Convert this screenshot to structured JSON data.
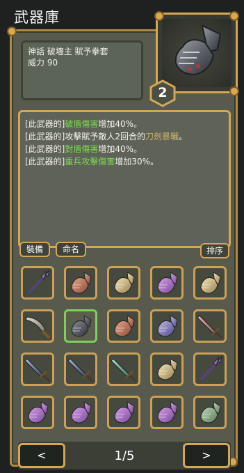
{
  "header": {
    "title": "武器庫"
  },
  "weapon": {
    "name": "神話  破墻主 賦予拳套",
    "power": "威力 90",
    "count": "2",
    "effects": [
      {
        "prefix": "[此武器的]",
        "highlight": "破盾傷害",
        "suffix": "增加40%。",
        "color": "green"
      },
      {
        "prefix": "[此武器的]攻擊賦予敵人2回合的",
        "highlight": "刀劍暴曬",
        "suffix": "。",
        "color": "gold"
      },
      {
        "prefix": "[此武器的]",
        "highlight": "對盾傷害",
        "suffix": "增加40%。",
        "color": "green"
      },
      {
        "prefix": "[此武器的]",
        "highlight": "重兵攻擊傷害",
        "suffix": "增加30%。",
        "color": "green"
      }
    ]
  },
  "buttons": {
    "equip": "裝備",
    "rename": "命名",
    "sort": "排序"
  },
  "inventory": [
    {
      "type": "spear",
      "tone": "purple"
    },
    {
      "type": "gauntlet",
      "tone": "copper"
    },
    {
      "type": "gauntlet",
      "tone": "gold"
    },
    {
      "type": "gauntlet",
      "tone": "violet"
    },
    {
      "type": "gauntlet",
      "tone": "gold"
    },
    {
      "type": "scimitar",
      "tone": "silver"
    },
    {
      "type": "gauntlet",
      "tone": "dark",
      "selected": true
    },
    {
      "type": "gauntlet",
      "tone": "copper"
    },
    {
      "type": "gauntlet",
      "tone": "royal"
    },
    {
      "type": "sword",
      "tone": "rose"
    },
    {
      "type": "sword",
      "tone": "steelblue"
    },
    {
      "type": "sword",
      "tone": "steelblue"
    },
    {
      "type": "sword",
      "tone": "jade"
    },
    {
      "type": "gauntlet",
      "tone": "gold"
    },
    {
      "type": "spear",
      "tone": "purple"
    },
    {
      "type": "gauntlet",
      "tone": "violet"
    },
    {
      "type": "gauntlet",
      "tone": "violet"
    },
    {
      "type": "gauntlet",
      "tone": "violet"
    },
    {
      "type": "gauntlet",
      "tone": "violet"
    },
    {
      "type": "gauntlet",
      "tone": "green"
    }
  ],
  "pagination": {
    "prev": "<",
    "next": ">",
    "page": "1/5"
  },
  "colors": {
    "gold_border": "#d4a655",
    "selected_border": "#7ed05a",
    "highlight_green": "#7cdc52",
    "highlight_gold": "#c8b06a"
  }
}
